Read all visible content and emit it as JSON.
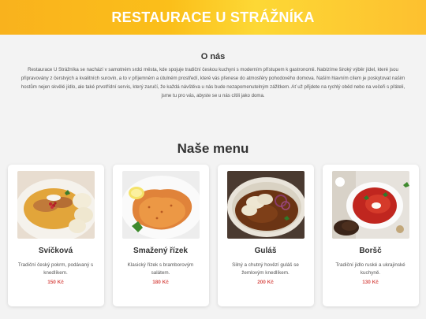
{
  "header": {
    "title": "RESTAURACE U STRÁŽNÍKA"
  },
  "about": {
    "heading": "O nás",
    "text": "Restaurace U Strážníka se nachází v samotném srdci města, kde spojuje tradiční českou kuchyni s moderním přístupem k gastronomii. Nabízíme široký výběr jídel, které jsou připravovány z čerstvých a kvalitních surovin, a to v příjemném a útulném prostředí, které vás přenese do atmosféry pohodového domova. Naším hlavním cílem je poskytovat našim hostům nejen skvělé jídlo, ale také prvotřídní servis, který zaručí, že každá návštěva u nás bude nezapomenutelným zážitkem. Ať už přijdete na rychlý oběd nebo na večeři s přáteli, jsme tu pro vás, abyste se u nás cítili jako doma."
  },
  "menu": {
    "title": "Naše menu",
    "items": [
      {
        "name": "Svíčková",
        "description": "Tradiční český pokrm, podávaný s knedlíkem.",
        "price": "150 Kč"
      },
      {
        "name": "Smažený řízek",
        "description": "Klasický řízek s bramborovým salátem.",
        "price": "180 Kč"
      },
      {
        "name": "Guláš",
        "description": "Silný a chutný hovězí guláš se žemlovým knedlíkem.",
        "price": "200 Kč"
      },
      {
        "name": "Boršč",
        "description": "Tradiční jídlo ruské a ukrajinské kuchyně.",
        "price": "130 Kč"
      }
    ]
  },
  "colors": {
    "header_gradient_start": "#f9b21d",
    "header_gradient_end": "#fdc02f",
    "price": "#d9534f"
  }
}
